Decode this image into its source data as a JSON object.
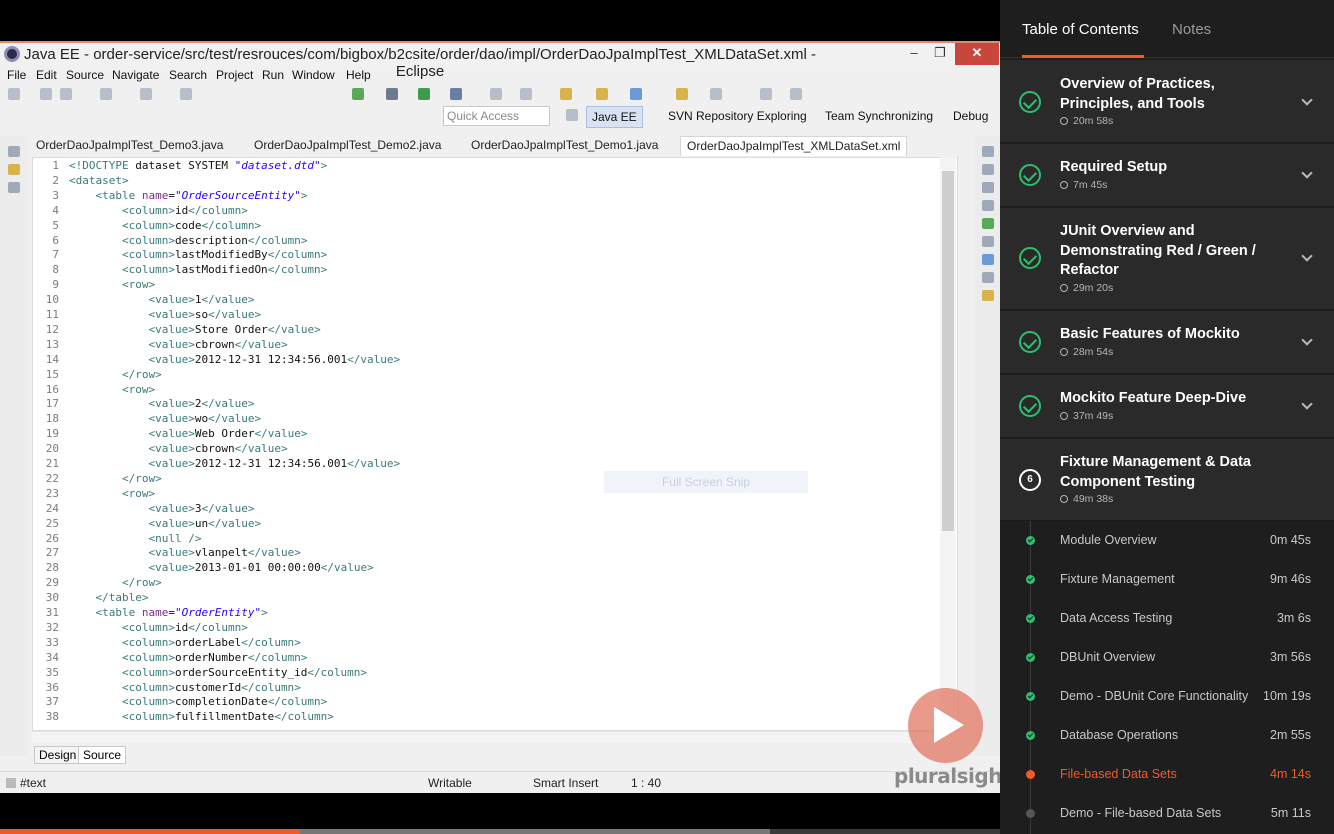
{
  "eclipse": {
    "window_title": "Java EE - order-service/src/test/resrouces/com/bigbox/b2csite/order/dao/impl/OrderDaoJpaImplTest_XMLDataSet.xml - Eclipse",
    "minimize": "–",
    "maximize": "❐",
    "close": "✕",
    "menu": [
      "File",
      "Edit",
      "Source",
      "Navigate",
      "Search",
      "Project",
      "Run",
      "Window",
      "Help"
    ],
    "quick_access_placeholder": "Quick Access",
    "perspectives": [
      "Java EE",
      "SVN Repository Exploring",
      "Team Synchronizing",
      "Debug"
    ],
    "tabs": [
      {
        "label": "OrderDaoJpaImplTest_Demo3.java",
        "active": false
      },
      {
        "label": "OrderDaoJpaImplTest_Demo2.java",
        "active": false
      },
      {
        "label": "OrderDaoJpaImplTest_Demo1.java",
        "active": false
      },
      {
        "label": "OrderDaoJpaImplTest_XMLDataSet.xml",
        "active": true
      }
    ],
    "code_lines": [
      "<!DOCTYPE dataset SYSTEM \"dataset.dtd\">",
      "<dataset>",
      "    <table name=\"OrderSourceEntity\">",
      "        <column>id</column>",
      "        <column>code</column>",
      "        <column>description</column>",
      "        <column>lastModifiedBy</column>",
      "        <column>lastModifiedOn</column>",
      "        <row>",
      "            <value>1</value>",
      "            <value>so</value>",
      "            <value>Store Order</value>",
      "            <value>cbrown</value>",
      "            <value>2012-12-31 12:34:56.001</value>",
      "        </row>",
      "        <row>",
      "            <value>2</value>",
      "            <value>wo</value>",
      "            <value>Web Order</value>",
      "            <value>cbrown</value>",
      "            <value>2012-12-31 12:34:56.001</value>",
      "        </row>",
      "        <row>",
      "            <value>3</value>",
      "            <value>un</value>",
      "            <null />",
      "            <value>vlanpelt</value>",
      "            <value>2013-01-01 00:00:00</value>",
      "        </row>",
      "    </table>",
      "    <table name=\"OrderEntity\">",
      "        <column>id</column>",
      "        <column>orderLabel</column>",
      "        <column>orderNumber</column>",
      "        <column>orderSourceEntity_id</column>",
      "        <column>customerId</column>",
      "        <column>completionDate</column>",
      "        <column>fulfillmentDate</column>"
    ],
    "bottom_tabs": [
      "Design",
      "Source"
    ],
    "status": {
      "node": "#text",
      "writable": "Writable",
      "insert_mode": "Smart Insert",
      "position": "1 : 40"
    },
    "overlay_watermark": "Full Screen Snip"
  },
  "player": {
    "brand": "pluralsight",
    "progress": 0.3,
    "buffered_to": 0.77
  },
  "sidebar": {
    "tabs": [
      "Table of Contents",
      "Notes"
    ],
    "modules": [
      {
        "title": "Overview of Practices, Principles, and Tools",
        "duration": "20m 58s",
        "completed": true
      },
      {
        "title": "Required Setup",
        "duration": "7m 45s",
        "completed": true
      },
      {
        "title": "JUnit Overview and Demonstrating Red / Green / Refactor",
        "duration": "29m 20s",
        "completed": true
      },
      {
        "title": "Basic Features of Mockito",
        "duration": "28m 54s",
        "completed": true
      },
      {
        "title": "Mockito Feature Deep-Dive",
        "duration": "37m 49s",
        "completed": true
      }
    ],
    "current_module": {
      "number": "6",
      "title": "Fixture Management & Data Component Testing",
      "duration": "49m 38s"
    },
    "clips": [
      {
        "title": "Module Overview",
        "duration": "0m 45s",
        "state": "done"
      },
      {
        "title": "Fixture Management",
        "duration": "9m 46s",
        "state": "done"
      },
      {
        "title": "Data Access Testing",
        "duration": "3m 6s",
        "state": "done"
      },
      {
        "title": "DBUnit Overview",
        "duration": "3m 56s",
        "state": "done"
      },
      {
        "title": "Demo - DBUnit Core Functionality",
        "duration": "10m 19s",
        "state": "done"
      },
      {
        "title": "Database Operations",
        "duration": "2m 55s",
        "state": "done"
      },
      {
        "title": "File-based Data Sets",
        "duration": "4m 14s",
        "state": "current"
      },
      {
        "title": "Demo - File-based Data Sets",
        "duration": "5m 11s",
        "state": "pending"
      }
    ],
    "colors": {
      "accent": "#f15b2a",
      "check": "#2fbd6f",
      "panel": "#2a2a2a",
      "background": "#1e1e1e"
    }
  }
}
